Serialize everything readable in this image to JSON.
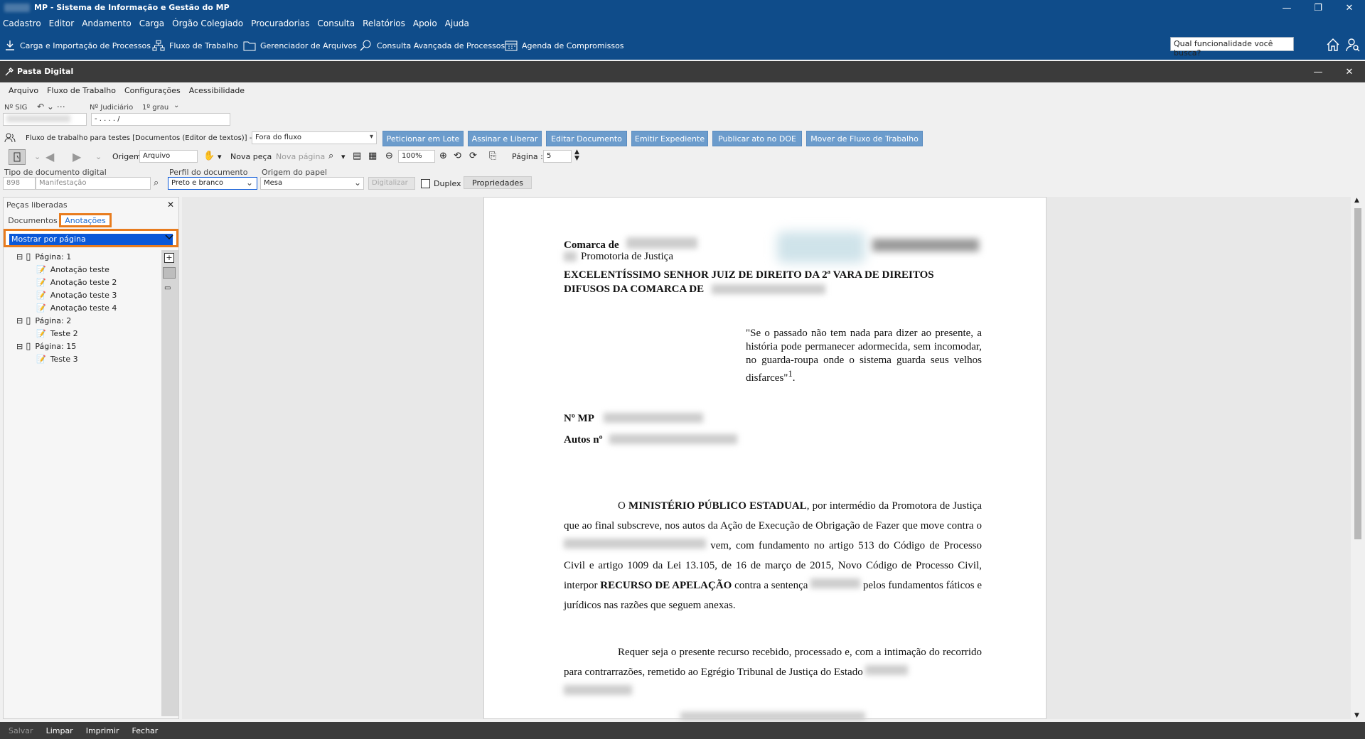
{
  "app": {
    "title": "MP - Sistema de Informação e Gestão do MP"
  },
  "menu": [
    "Cadastro",
    "Editor",
    "Andamento",
    "Carga",
    "Órgão Colegiado",
    "Procuradorias",
    "Consulta",
    "Relatórios",
    "Apoio",
    "Ajuda"
  ],
  "toolbar": {
    "carga": "Carga e Importação de Processos",
    "fluxo": "Fluxo de Trabalho",
    "gerenciador": "Gerenciador de Arquivos",
    "consulta": "Consulta Avançada de Processos",
    "agenda": "Agenda de Compromissos",
    "search_placeholder": "Qual funcionalidade você busca?"
  },
  "pasta": {
    "title": "Pasta Digital"
  },
  "submenu": [
    "Arquivo",
    "Fluxo de Trabalho",
    "Configurações",
    "Acessibilidade"
  ],
  "info": {
    "sig_label": "Nº SIG",
    "judiciario_label": "Nº Judiciário",
    "grau": "1º grau",
    "judiciario_value": "-  .   . . .  /"
  },
  "workflow": {
    "text": "Fluxo de trabalho para testes [Documentos (Editor de textos)] - Fila",
    "fila": "Fora do fluxo",
    "buttons": [
      "Peticionar em Lote",
      "Assinar e Liberar",
      "Editar Documento",
      "Emitir Expediente",
      "Publicar ato no DOE",
      "Mover de Fluxo de Trabalho"
    ]
  },
  "doctoolbar": {
    "origem_label": "Origem",
    "origem_value": "Arquivo",
    "nova_peca": "Nova peça",
    "nova_pagina": "Nova página",
    "zoom": "100%",
    "pagina_label": "Página :",
    "pagina_value": "5"
  },
  "docinfo": {
    "tipo_label": "Tipo de documento digital",
    "tipo_code": "898",
    "tipo_value": "Manifestação",
    "perfil_label": "Perfil do documento",
    "perfil_value": "Preto e branco",
    "origem_papel_label": "Origem do papel",
    "origem_papel_value": "Mesa",
    "digitalizar": "Digitalizar",
    "duplex": "Duplex",
    "propriedades": "Propriedades"
  },
  "panel": {
    "title": "Peças liberadas",
    "tab_documentos": "Documentos",
    "tab_anotacoes": "Anotações",
    "mostrar": "Mostrar por página",
    "tree": [
      {
        "label": "Página: 1",
        "level": 0
      },
      {
        "label": "Anotação teste",
        "level": 1
      },
      {
        "label": "Anotação teste 2",
        "level": 1
      },
      {
        "label": "Anotação teste 3",
        "level": 1
      },
      {
        "label": "Anotação teste 4",
        "level": 1
      },
      {
        "label": "Página: 2",
        "level": 0
      },
      {
        "label": "Teste 2",
        "level": 1
      },
      {
        "label": "Página: 15",
        "level": 0
      },
      {
        "label": "Teste 3",
        "level": 1
      }
    ]
  },
  "document": {
    "comarca": "Comarca de",
    "promotoria": "Promotoria de Justiça",
    "header1": "EXCELENTÍSSIMO SENHOR JUIZ DE DIREITO DA 2ª VARA DE DIREITOS",
    "header2": "DIFUSOS DA COMARCA DE",
    "quote": "\"Se o passado não tem nada para dizer ao presente, a história pode permanecer adormecida, sem incomodar, no guarda-roupa onde o sistema guarda seus velhos disfarces\"",
    "quote_note": "1",
    "nmp": "Nº MP",
    "autos": "Autos nº",
    "p1_start": "O",
    "p1_bold": "MINISTÉRIO PÚBLICO ESTADUAL",
    "p1_a": ", por intermédio da Promotora de Justiça que ao final subscreve, nos autos da Ação de Execução de Obrigação de Fazer que move contra o",
    "p1_b": "vem, com fundamento no artigo 513 do Código de Processo Civil e artigo 1009 da Lei 13.105, de 16 de março de 2015, Novo Código de Processo Civil, interpor",
    "p1_bold2": "RECURSO DE APELAÇÃO",
    "p1_c": "contra a sentença",
    "p1_d": "pelos fundamentos fáticos e jurídicos nas razões que seguem anexas.",
    "p2": "Requer seja o presente recurso recebido, processado e, com a intimação do recorrido para contrarrazões,  remetido ao Egrégio Tribunal de Justiça do Estado"
  },
  "bottom": [
    "Salvar",
    "Limpar",
    "Imprimir",
    "Fechar"
  ]
}
